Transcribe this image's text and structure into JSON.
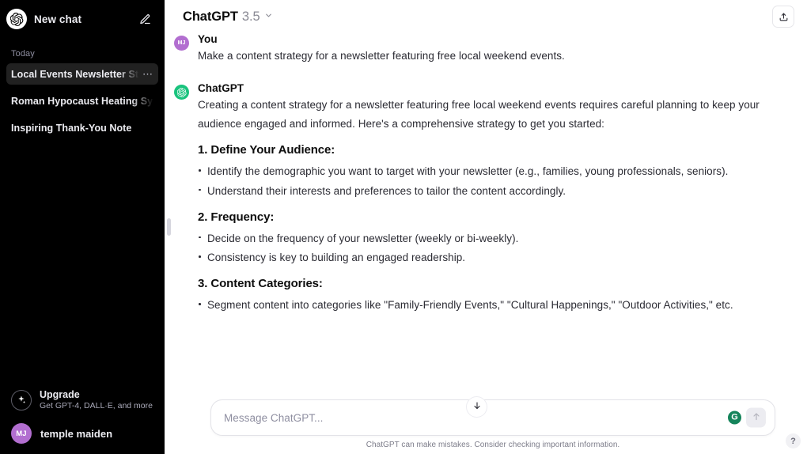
{
  "sidebar": {
    "logo_icon": "openai-logo-icon",
    "new_chat_label": "New chat",
    "compose_icon": "compose-pencil-icon",
    "section_label": "Today",
    "chats": [
      {
        "title": "Local Events Newsletter Strategy",
        "menu_icon": "ellipsis-icon",
        "active": true
      },
      {
        "title": "Roman Hypocaust Heating System",
        "active": false
      },
      {
        "title": "Inspiring Thank-You Note",
        "active": false
      }
    ],
    "upgrade": {
      "icon": "sparkle-icon",
      "title": "Upgrade",
      "subtitle": "Get GPT-4, DALL·E, and more"
    },
    "user": {
      "initials": "MJ",
      "name": "temple maiden",
      "avatar_color": "#b26ed0"
    }
  },
  "header": {
    "model_name": "ChatGPT",
    "model_version": "3.5",
    "chevron_icon": "chevron-down-icon",
    "share_icon": "share-upload-icon"
  },
  "conversation": {
    "messages": [
      {
        "author": "You",
        "avatar_initials": "MJ",
        "avatar_type": "user",
        "text": "Make a content strategy for a newsletter featuring free local weekend events."
      },
      {
        "author": "ChatGPT",
        "avatar_type": "bot",
        "avatar_icon": "openai-logo-icon",
        "text": "Creating a content strategy for a newsletter featuring free local weekend events requires careful planning to keep your audience engaged and informed. Here's a comprehensive strategy to get you started:",
        "sections": [
          {
            "heading": "1. Define Your Audience:",
            "bullets": [
              "Identify the demographic you want to target with your newsletter (e.g., families, young professionals, seniors).",
              "Understand their interests and preferences to tailor the content accordingly."
            ]
          },
          {
            "heading": "2. Frequency:",
            "bullets": [
              "Decide on the frequency of your newsletter (weekly or bi-weekly).",
              "Consistency is key to building an engaged readership."
            ]
          },
          {
            "heading": "3. Content Categories:",
            "bullets": [
              "Segment content into categories like \"Family-Friendly Events,\" \"Cultural Happenings,\" \"Outdoor Activities,\" etc."
            ]
          }
        ]
      }
    ]
  },
  "scroll_button": {
    "icon": "arrow-down-icon"
  },
  "composer": {
    "placeholder": "Message ChatGPT...",
    "value": "",
    "grammarly_icon": "grammarly-icon",
    "grammarly_glyph": "G",
    "send_icon": "arrow-up-icon"
  },
  "footer": {
    "disclaimer": "ChatGPT can make mistakes. Consider checking important information.",
    "help_glyph": "?",
    "help_icon": "question-mark-icon"
  },
  "colors": {
    "sidebar_bg": "#000000",
    "active_chat_bg": "#212121",
    "accent_green": "#19c37d",
    "avatar_purple": "#b26ed0",
    "grammarly_green": "#15845b"
  }
}
